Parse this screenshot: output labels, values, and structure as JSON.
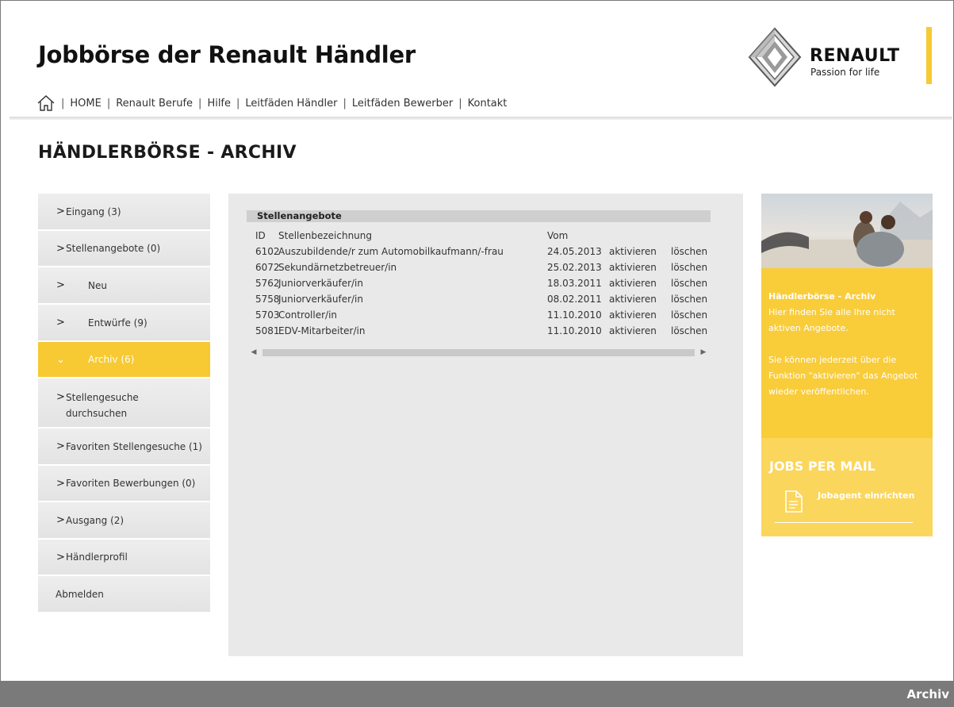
{
  "header": {
    "site_title": "Jobbörse der Renault Händler",
    "brand_name": "RENAULT",
    "brand_tagline": "Passion for life",
    "brand_color": "#f7c933"
  },
  "topnav": {
    "home_icon": "home-icon",
    "items": [
      "HOME",
      "Renault Berufe",
      "Hilfe",
      "Leitfäden Händler",
      "Leitfäden Bewerber",
      "Kontakt"
    ]
  },
  "page_title": "HÄNDLERBÖRSE - ARCHIV",
  "sidebar": {
    "items": [
      {
        "label": "Eingang (3)"
      },
      {
        "label": "Stellenangebote (0)"
      },
      {
        "label": "Neu"
      },
      {
        "label": "Entwürfe (9)"
      },
      {
        "label": "Archiv (6)",
        "active": true
      },
      {
        "label_line1": "Stellengesuche",
        "label_line2": "durchsuchen"
      },
      {
        "label": "Favoriten Stellengesuche (1)"
      },
      {
        "label": "Favoriten Bewerbungen (0)"
      },
      {
        "label": "Ausgang (2)"
      },
      {
        "label": "Händlerprofil"
      },
      {
        "label": "Abmelden"
      }
    ],
    "chevron_right": ">",
    "chevron_down": "⌄"
  },
  "table": {
    "title": "Stellenangebote",
    "columns": {
      "id": "ID",
      "title": "Stellenbezeichnung",
      "date": "Vom"
    },
    "rows": [
      {
        "id": "6102",
        "title": "Auszubildende/r zum Automobilkaufmann/-frau",
        "date": "24.05.2013",
        "activate": "aktivieren",
        "delete": "löschen"
      },
      {
        "id": "6072",
        "title": "Sekundärnetzbetreuer/in",
        "date": "25.02.2013",
        "activate": "aktivieren",
        "delete": "löschen"
      },
      {
        "id": "5762",
        "title": "Juniorverkäufer/in",
        "date": "18.03.2011",
        "activate": "aktivieren",
        "delete": "löschen"
      },
      {
        "id": "5758",
        "title": "Juniorverkäufer/in",
        "date": "08.02.2011",
        "activate": "aktivieren",
        "delete": "löschen"
      },
      {
        "id": "5703",
        "title": "Controller/in",
        "date": "11.10.2010",
        "activate": "aktivieren",
        "delete": "löschen"
      },
      {
        "id": "5081",
        "title": "EDV-Mitarbeiter/in",
        "date": "11.10.2010",
        "activate": "aktivieren",
        "delete": "löschen"
      }
    ],
    "scroll_left": "◀",
    "scroll_right": "▶"
  },
  "aside": {
    "info_title": "Händlerbörse - Archiv",
    "info_text1": "Hier finden Sie alle Ihre nicht aktiven Angebote.",
    "info_text2": "Sie können jederzeit über die Funktion \"aktivieren\" das Angebot wieder veröffentlichen.",
    "mail_title": "JOBS PER MAIL",
    "mail_link": "Jobagent einrichten",
    "mail_icon": "document-icon"
  },
  "footer": {
    "label": "Archiv"
  }
}
